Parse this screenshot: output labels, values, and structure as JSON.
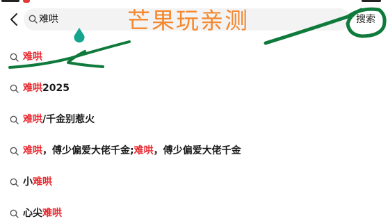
{
  "search": {
    "query": "难哄",
    "button_label": "搜索"
  },
  "watermark": "芒果玩亲测",
  "suggestions": [
    {
      "parts": [
        {
          "t": "难哄",
          "hl": true
        }
      ]
    },
    {
      "parts": [
        {
          "t": "难哄",
          "hl": true
        },
        {
          "t": "2025",
          "hl": false
        }
      ]
    },
    {
      "parts": [
        {
          "t": "难哄",
          "hl": true
        },
        {
          "t": "/千金别惹火",
          "hl": false
        }
      ]
    },
    {
      "parts": [
        {
          "t": "难哄",
          "hl": true
        },
        {
          "t": "，傅少偏爱大佬千金;",
          "hl": false
        },
        {
          "t": "难哄",
          "hl": true
        },
        {
          "t": "，傅少偏爱大佬千金",
          "hl": false
        }
      ]
    },
    {
      "parts": [
        {
          "t": "小",
          "hl": false
        },
        {
          "t": "难哄",
          "hl": true
        }
      ]
    },
    {
      "parts": [
        {
          "t": "心尖",
          "hl": false
        },
        {
          "t": "难哄",
          "hl": true
        }
      ]
    }
  ],
  "colors": {
    "highlight": "#e8262d",
    "annotation": "#0f7a3c",
    "watermark": "#f5872d"
  },
  "icons": {
    "back": "chevron-left-icon",
    "search": "search-icon"
  }
}
